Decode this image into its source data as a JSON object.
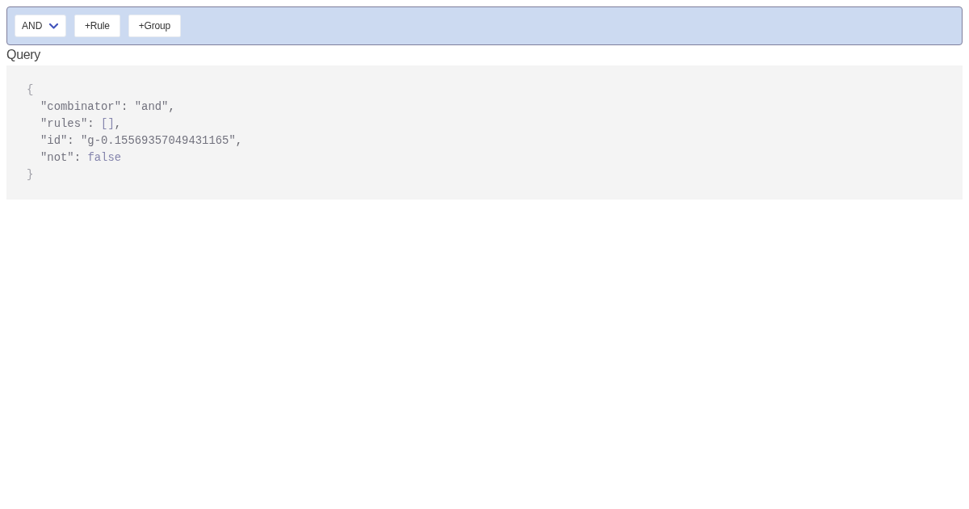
{
  "rule_group": {
    "combinator": {
      "value": "AND"
    },
    "buttons": [
      {
        "label": "+Rule"
      },
      {
        "label": "+Group"
      }
    ]
  },
  "query": {
    "title": "Query",
    "code": {
      "open": "{",
      "entries": [
        "\"combinator\": \"and\",",
        "\"rules\": [],",
        "\"id\": \"g-0.15569357049431165\",",
        "\"not\": false"
      ],
      "close": "}"
    }
  }
}
